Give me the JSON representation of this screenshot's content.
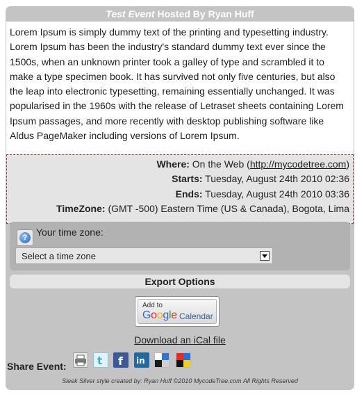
{
  "event": {
    "title_italic": "Test Event",
    "title_rest": " Hosted By Ryan Huff",
    "description": "Lorem Ipsum is simply dummy text of the printing and typesetting industry. Lorem Ipsum has been the industry's standard dummy text ever since the 1500s, when an unknown printer took a galley of type and scrambled it to make a type specimen book. It has survived not only five centuries, but also the leap into electronic typesetting, remaining essentially unchanged. It was popularised in the 1960s with the release of Letraset sheets containing Lorem Ipsum passages, and more recently with desktop publishing software like Aldus PageMaker including versions of Lorem Ipsum."
  },
  "details": {
    "where_label": "Where:",
    "where_value": "On the Web (",
    "where_link": "http://mycodetree.com",
    "where_close": ")",
    "starts_label": "Starts:",
    "starts_value": "Tuesday, August 24th 2010 02:36",
    "ends_label": "Ends:",
    "ends_value": "Tuesday, August 24th 2010 03:36",
    "timezone_label": "TimeZone:",
    "timezone_value": "(GMT -500) Eastern Time (US & Canada), Bogota, Lima"
  },
  "tz": {
    "label": "Your time zone:",
    "select_value": "Select a time zone",
    "icon": "help-question-icon"
  },
  "export": {
    "heading": "Export Options",
    "gcal_add_to": "Add to",
    "gcal_google": "Google",
    "gcal_calendar": "Calendar",
    "ical_link": "Download an iCal file"
  },
  "share": {
    "label": "Share Event:",
    "icons": [
      "print-icon",
      "twitter-icon",
      "facebook-icon",
      "linkedin-icon",
      "delicious-icon",
      "digg-icon"
    ]
  },
  "footer": {
    "credit": "Sleek Silver style created by: Ryan Huff ©2010 MycodeTree.com All Rights Reserved"
  },
  "colors": {
    "card_bg": "#c4c4c4",
    "details_border": "#9b3737",
    "panel_bg": "#e4e4e4"
  }
}
